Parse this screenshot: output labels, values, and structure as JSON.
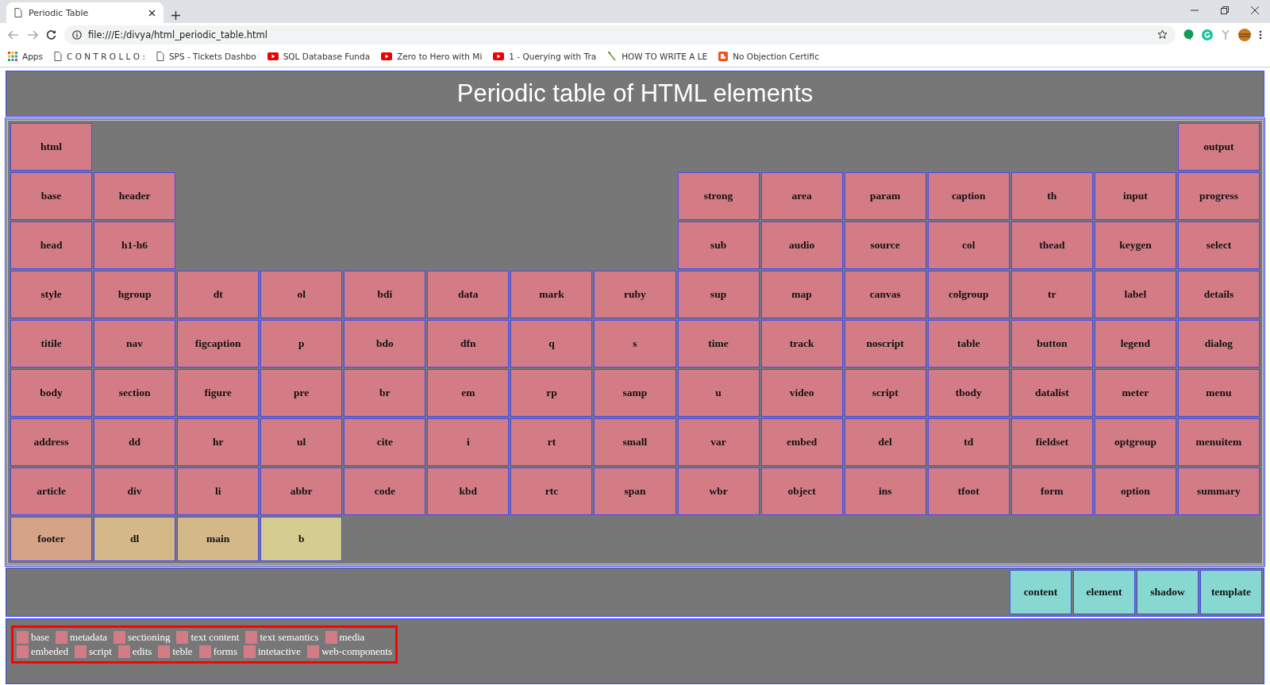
{
  "browser": {
    "tab": {
      "title": "Periodic Table",
      "selected": true
    },
    "url": "file:///E:/divya/html_periodic_table.html",
    "bookmarks": [
      {
        "label": "Apps",
        "kind": "apps"
      },
      {
        "label": "C O N T R O L L O :",
        "kind": "page"
      },
      {
        "label": "SPS - Tickets Dashbo",
        "kind": "page"
      },
      {
        "label": "SQL Database Funda",
        "kind": "video"
      },
      {
        "label": "Zero to Hero with Mi",
        "kind": "video"
      },
      {
        "label": "1 - Querying with Tra",
        "kind": "video"
      },
      {
        "label": "HOW TO WRITE A LE",
        "kind": "pen"
      },
      {
        "label": "No Objection Certific",
        "kind": "blog"
      }
    ]
  },
  "page": {
    "title": "Periodic table of HTML elements",
    "grid": {
      "rows": [
        {
          "left": [
            {
              "label": "html",
              "color": "#d47c86"
            }
          ],
          "right": [
            {
              "label": "output",
              "color": "#d47c86"
            }
          ]
        },
        {
          "left": [
            {
              "label": "base",
              "color": "#d47c86"
            },
            {
              "label": "header",
              "color": "#d47c86"
            }
          ],
          "right": [
            {
              "label": "strong",
              "color": "#d47c86"
            },
            {
              "label": "area",
              "color": "#d47c86"
            },
            {
              "label": "param",
              "color": "#d47c86"
            },
            {
              "label": "caption",
              "color": "#d47c86"
            },
            {
              "label": "th",
              "color": "#d47c86"
            },
            {
              "label": "input",
              "color": "#d47c86"
            },
            {
              "label": "progress",
              "color": "#d47c86"
            }
          ]
        },
        {
          "left": [
            {
              "label": "head",
              "color": "#d47c86"
            },
            {
              "label": "h1-h6",
              "color": "#d47c86"
            }
          ],
          "right": [
            {
              "label": "sub",
              "color": "#d47c86"
            },
            {
              "label": "audio",
              "color": "#d47c86"
            },
            {
              "label": "source",
              "color": "#d47c86"
            },
            {
              "label": "col",
              "color": "#d47c86"
            },
            {
              "label": "thead",
              "color": "#d47c86"
            },
            {
              "label": "keygen",
              "color": "#d47c86"
            },
            {
              "label": "select",
              "color": "#d47c86"
            }
          ]
        },
        {
          "left": [
            {
              "label": "style",
              "color": "#d47c86"
            },
            {
              "label": "hgroup",
              "color": "#d47c86"
            },
            {
              "label": "dt",
              "color": "#d47c86"
            },
            {
              "label": "ol",
              "color": "#d47c86"
            },
            {
              "label": "bdi",
              "color": "#d47c86"
            },
            {
              "label": "data",
              "color": "#d47c86"
            },
            {
              "label": "mark",
              "color": "#d47c86"
            },
            {
              "label": "ruby",
              "color": "#d47c86"
            },
            {
              "label": "sup",
              "color": "#d47c86"
            },
            {
              "label": "map",
              "color": "#d47c86"
            },
            {
              "label": "canvas",
              "color": "#d47c86"
            },
            {
              "label": "colgroup",
              "color": "#d47c86"
            },
            {
              "label": "tr",
              "color": "#d47c86"
            },
            {
              "label": "label",
              "color": "#d47c86"
            },
            {
              "label": "details",
              "color": "#d47c86"
            }
          ],
          "right": []
        },
        {
          "left": [
            {
              "label": "titile",
              "color": "#d47c86"
            },
            {
              "label": "nav",
              "color": "#d47c86"
            },
            {
              "label": "figcaption",
              "color": "#d47c86"
            },
            {
              "label": "p",
              "color": "#d47c86"
            },
            {
              "label": "bdo",
              "color": "#d47c86"
            },
            {
              "label": "dfn",
              "color": "#d47c86"
            },
            {
              "label": "q",
              "color": "#d47c86"
            },
            {
              "label": "s",
              "color": "#d47c86"
            },
            {
              "label": "time",
              "color": "#d47c86"
            },
            {
              "label": "track",
              "color": "#d47c86"
            },
            {
              "label": "noscript",
              "color": "#d47c86"
            },
            {
              "label": "table",
              "color": "#d47c86"
            },
            {
              "label": "button",
              "color": "#d47c86"
            },
            {
              "label": "legend",
              "color": "#d47c86"
            },
            {
              "label": "dialog",
              "color": "#d47c86"
            }
          ],
          "right": []
        },
        {
          "left": [
            {
              "label": "body",
              "color": "#d47c86"
            },
            {
              "label": "section",
              "color": "#d47c86"
            },
            {
              "label": "figure",
              "color": "#d47c86"
            },
            {
              "label": "pre",
              "color": "#d47c86"
            },
            {
              "label": "br",
              "color": "#d47c86"
            },
            {
              "label": "em",
              "color": "#d47c86"
            },
            {
              "label": "rp",
              "color": "#d47c86"
            },
            {
              "label": "samp",
              "color": "#d47c86"
            },
            {
              "label": "u",
              "color": "#d47c86"
            },
            {
              "label": "video",
              "color": "#d47c86"
            },
            {
              "label": "script",
              "color": "#d47c86"
            },
            {
              "label": "tbody",
              "color": "#d47c86"
            },
            {
              "label": "datalist",
              "color": "#d47c86"
            },
            {
              "label": "meter",
              "color": "#d47c86"
            },
            {
              "label": "menu",
              "color": "#d47c86"
            }
          ],
          "right": []
        },
        {
          "left": [
            {
              "label": "address",
              "color": "#d47c86"
            },
            {
              "label": "dd",
              "color": "#d47c86"
            },
            {
              "label": "hr",
              "color": "#d47c86"
            },
            {
              "label": "ul",
              "color": "#d47c86"
            },
            {
              "label": "cite",
              "color": "#d47c86"
            },
            {
              "label": "i",
              "color": "#d47c86"
            },
            {
              "label": "rt",
              "color": "#d47c86"
            },
            {
              "label": "small",
              "color": "#d47c86"
            },
            {
              "label": "var",
              "color": "#d47c86"
            },
            {
              "label": "embed",
              "color": "#d47c86"
            },
            {
              "label": "del",
              "color": "#d47c86"
            },
            {
              "label": "td",
              "color": "#d47c86"
            },
            {
              "label": "fieldset",
              "color": "#d47c86"
            },
            {
              "label": "optgroup",
              "color": "#d47c86"
            },
            {
              "label": "menuitem",
              "color": "#d47c86"
            }
          ],
          "right": []
        },
        {
          "left": [
            {
              "label": "article",
              "color": "#d47c86"
            },
            {
              "label": "div",
              "color": "#d47c86"
            },
            {
              "label": "li",
              "color": "#d47c86"
            },
            {
              "label": "abbr",
              "color": "#d47c86"
            },
            {
              "label": "code",
              "color": "#d47c86"
            },
            {
              "label": "kbd",
              "color": "#d47c86"
            },
            {
              "label": "rtc",
              "color": "#d47c86"
            },
            {
              "label": "span",
              "color": "#d47c86"
            },
            {
              "label": "wbr",
              "color": "#d47c86"
            },
            {
              "label": "object",
              "color": "#d47c86"
            },
            {
              "label": "ins",
              "color": "#d47c86"
            },
            {
              "label": "tfoot",
              "color": "#d47c86"
            },
            {
              "label": "form",
              "color": "#d47c86"
            },
            {
              "label": "option",
              "color": "#d47c86"
            },
            {
              "label": "summary",
              "color": "#d47c86"
            }
          ],
          "right": []
        },
        {
          "left": [
            {
              "label": "footer",
              "color": "#d4a388"
            },
            {
              "label": "dl",
              "color": "#d4b888"
            },
            {
              "label": "main",
              "color": "#d4b888"
            },
            {
              "label": "b",
              "color": "#d4cd8f"
            }
          ],
          "right": []
        }
      ]
    },
    "components": [
      {
        "label": "content",
        "color": "#88d8d2"
      },
      {
        "label": "element",
        "color": "#88d8d2"
      },
      {
        "label": "shadow",
        "color": "#88d8d2"
      },
      {
        "label": "template",
        "color": "#88d8d2"
      }
    ],
    "legend": [
      [
        {
          "label": "base",
          "color": "#d47c86"
        },
        {
          "label": "metadata",
          "color": "#d47c86"
        },
        {
          "label": "sectioning",
          "color": "#d47c86"
        },
        {
          "label": "text content",
          "color": "#d47c86"
        },
        {
          "label": "text semantics",
          "color": "#d47c86"
        },
        {
          "label": "media",
          "color": "#d47c86"
        }
      ],
      [
        {
          "label": "embeded",
          "color": "#d47c86"
        },
        {
          "label": "script",
          "color": "#d47c86"
        },
        {
          "label": "edits",
          "color": "#d47c86"
        },
        {
          "label": "teble",
          "color": "#d47c86"
        },
        {
          "label": "forms",
          "color": "#d47c86"
        },
        {
          "label": "intetactive",
          "color": "#d47c86"
        },
        {
          "label": "web-components",
          "color": "#d47c86"
        }
      ]
    ]
  }
}
